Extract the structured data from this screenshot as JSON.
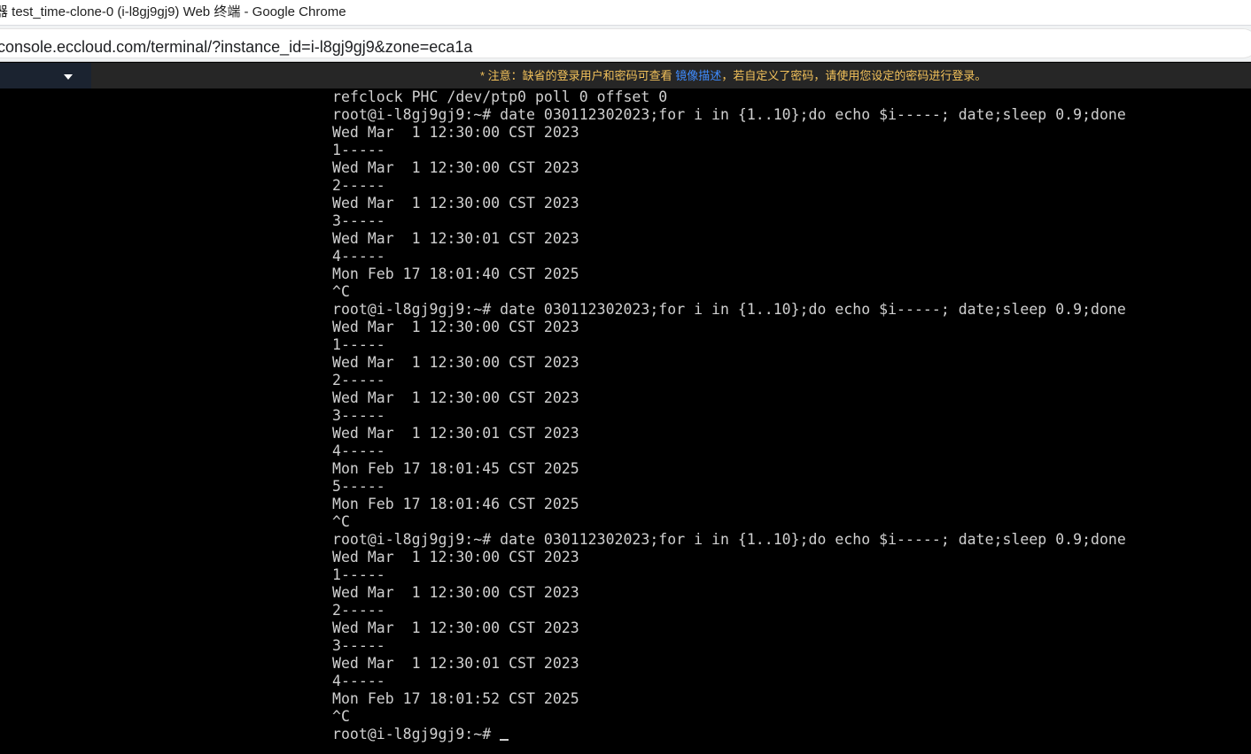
{
  "window": {
    "title": "器 test_time-clone-0 (i-l8gj9gj9) Web 终端 - Google Chrome"
  },
  "address_bar": {
    "url": "console.eccloud.com/terminal/?instance_id=i-l8gj9gj9&zone=eca1a"
  },
  "notice": {
    "prefix": "* 注意：缺省的登录用户和密码可查看 ",
    "link": "镜像描述",
    "suffix": "，若自定义了密码，请使用您设定的密码进行登录。",
    "colors": {
      "text": "#f3c25b",
      "link": "#3f8cff"
    }
  },
  "instance_selector": {
    "icon": "chevron-down-icon"
  },
  "terminal": {
    "lines": [
      "refclock PHC /dev/ptp0 poll 0 offset 0",
      "root@i-l8gj9gj9:~# date 030112302023;for i in {1..10};do echo $i-----; date;sleep 0.9;done",
      "Wed Mar  1 12:30:00 CST 2023",
      "1-----",
      "Wed Mar  1 12:30:00 CST 2023",
      "2-----",
      "Wed Mar  1 12:30:00 CST 2023",
      "3-----",
      "Wed Mar  1 12:30:01 CST 2023",
      "4-----",
      "Mon Feb 17 18:01:40 CST 2025",
      "^C",
      "root@i-l8gj9gj9:~# date 030112302023;for i in {1..10};do echo $i-----; date;sleep 0.9;done",
      "Wed Mar  1 12:30:00 CST 2023",
      "1-----",
      "Wed Mar  1 12:30:00 CST 2023",
      "2-----",
      "Wed Mar  1 12:30:00 CST 2023",
      "3-----",
      "Wed Mar  1 12:30:01 CST 2023",
      "4-----",
      "Mon Feb 17 18:01:45 CST 2025",
      "5-----",
      "Mon Feb 17 18:01:46 CST 2025",
      "^C",
      "root@i-l8gj9gj9:~# date 030112302023;for i in {1..10};do echo $i-----; date;sleep 0.9;done",
      "Wed Mar  1 12:30:00 CST 2023",
      "1-----",
      "Wed Mar  1 12:30:00 CST 2023",
      "2-----",
      "Wed Mar  1 12:30:00 CST 2023",
      "3-----",
      "Wed Mar  1 12:30:01 CST 2023",
      "4-----",
      "Mon Feb 17 18:01:52 CST 2025",
      "^C"
    ],
    "prompt": "root@i-l8gj9gj9:~#",
    "colors": {
      "background": "#000000",
      "text": "#d0d0d0"
    }
  }
}
